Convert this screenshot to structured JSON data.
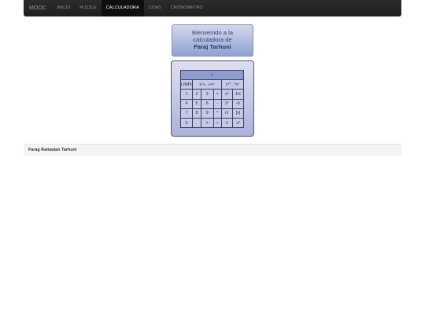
{
  "navbar": {
    "brand": "MOOC",
    "items": [
      {
        "label": "INICIO"
      },
      {
        "label": "PUZZLE"
      },
      {
        "label": "CALCULADORA"
      },
      {
        "label": "CITAS"
      },
      {
        "label": "CRONOMETRO"
      }
    ],
    "active": "CALCULADORA"
  },
  "welcome": {
    "line1": "Bienvenido a la",
    "line2": "calculadora de",
    "name": "Faraj Tarhuni"
  },
  "calculator": {
    "display": "0",
    "rows": [
      [
        "LIMPIAR",
        "x²+...+xⁿ",
        "x¹*...*xⁿ"
      ],
      [
        "1",
        "2",
        "3",
        "+",
        "x²",
        "1/x"
      ],
      [
        "4",
        "5",
        "6",
        "-",
        "2ˣ",
        "√x"
      ],
      [
        "7",
        "8",
        "9",
        "*",
        "n!",
        "[x]"
      ],
      [
        "0",
        ".",
        "=",
        "÷",
        "±",
        "x³"
      ]
    ]
  },
  "footer": {
    "text": "Farag Ramadan Tarhuni"
  }
}
